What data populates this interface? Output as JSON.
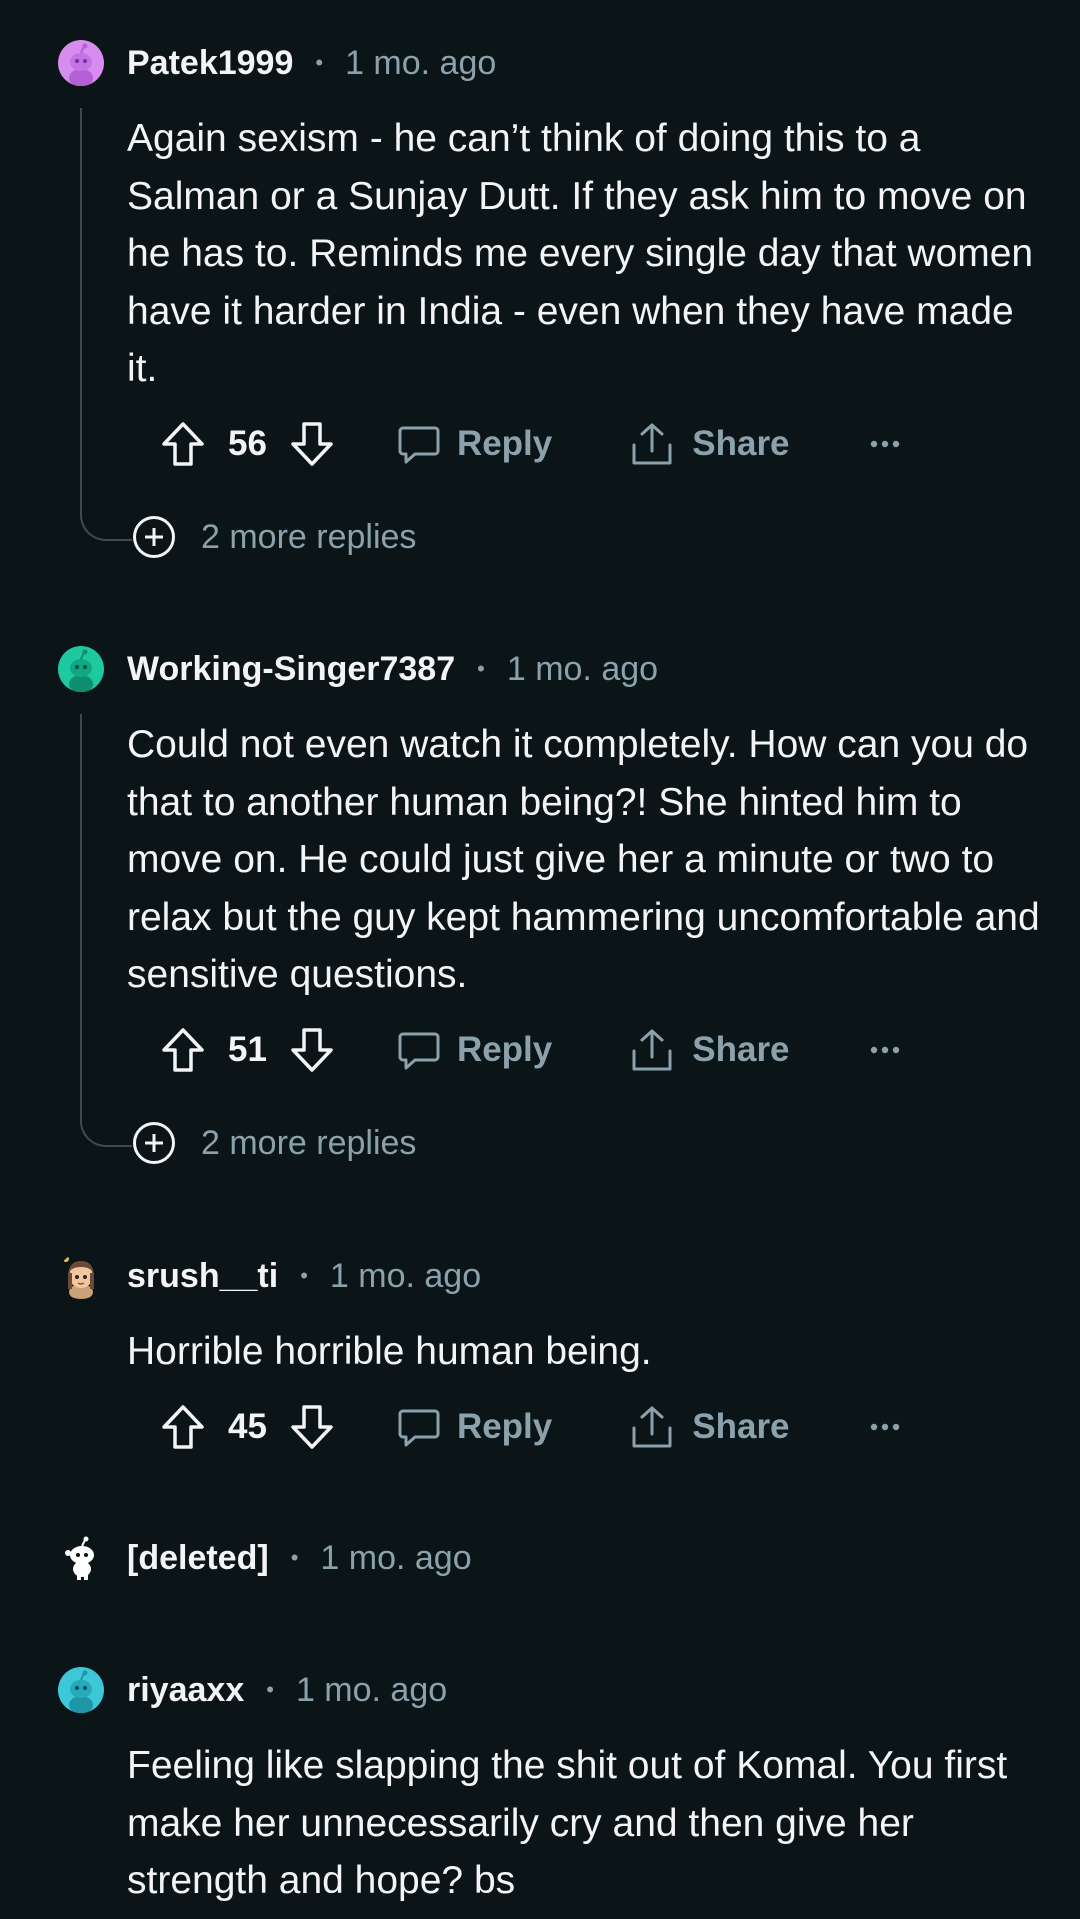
{
  "comments": [
    {
      "username": "Patek1999",
      "time": "1 mo. ago",
      "avatar_color": "#d78cf0",
      "body": "Again sexism - he can’t think of doing this to a Salman or a Sunjay Dutt. If they ask him to move on he has to. Reminds me every single day that women have it harder in India - even when they have made it.",
      "votes": "56",
      "reply_label": "Reply",
      "share_label": "Share",
      "more_replies": "2 more replies"
    },
    {
      "username": "Working-Singer7387",
      "time": "1 mo. ago",
      "avatar_color": "#1ec8a0",
      "body": "Could not even watch it completely. How can you do that to another human being?! She hinted him to move on. He could just give her a minute or two to relax but the guy kept hammering uncomfortable and sensitive questions.",
      "votes": "51",
      "reply_label": "Reply",
      "share_label": "Share",
      "more_replies": "2 more replies"
    },
    {
      "username": "srush__ti",
      "time": "1 mo. ago",
      "avatar_color": "#6b4a3a",
      "body": "Horrible horrible human being.",
      "votes": "45",
      "reply_label": "Reply",
      "share_label": "Share"
    },
    {
      "username": "[deleted]",
      "time": "1 mo. ago",
      "avatar_color": "#ffffff"
    },
    {
      "username": "riyaaxx",
      "time": "1 mo. ago",
      "avatar_color": "#3cc8d8",
      "body": "Feeling like slapping the shit out of Komal. You first make her unnecessarily cry and then give her strength and hope? bs"
    }
  ],
  "separator": "•",
  "colors": {
    "background": "#0b1416",
    "text": "#f2f4f5",
    "muted": "#8ba2ad",
    "thread_line": "#3e4a4d"
  },
  "icons": {
    "upvote": "upvote-icon",
    "downvote": "downvote-icon",
    "reply": "comment-bubble-icon",
    "share": "share-icon",
    "more": "overflow-dots-icon",
    "expand": "plus-circle-icon"
  }
}
